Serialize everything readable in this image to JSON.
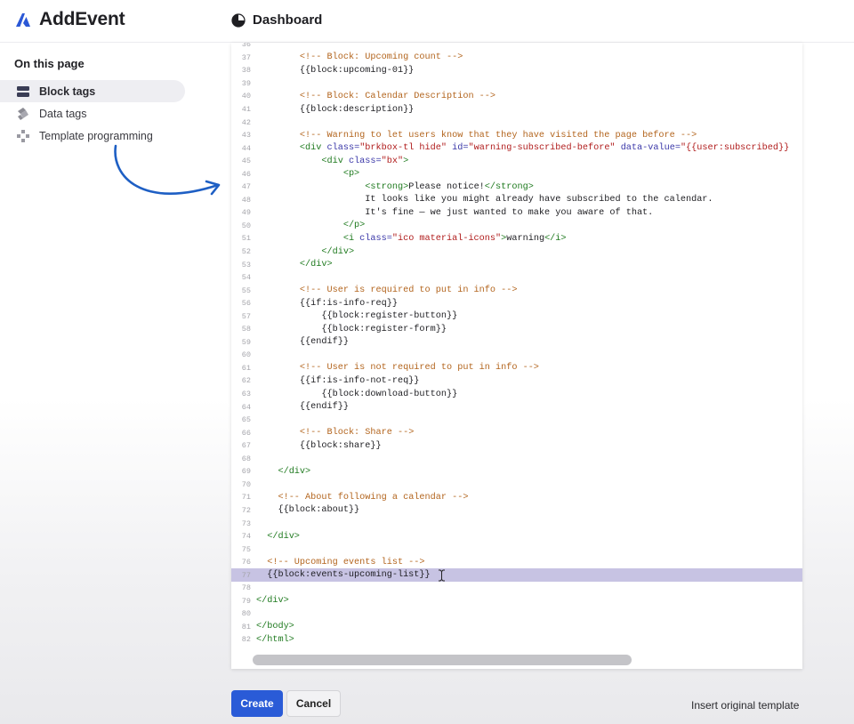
{
  "header": {
    "brand": "AddEvent",
    "nav_item": "Dashboard"
  },
  "sidebar": {
    "title": "On this page",
    "items": [
      {
        "label": "Block tags",
        "icon": "block-tags-icon",
        "active": true
      },
      {
        "label": "Data tags",
        "icon": "data-tags-icon",
        "active": false
      },
      {
        "label": "Template programming",
        "icon": "template-programming-icon",
        "active": false
      }
    ]
  },
  "editor": {
    "highlight_color": "#c7c3e3",
    "lines": [
      {
        "n": "36",
        "segs": [
          [
            "tx",
            ""
          ]
        ]
      },
      {
        "n": "37",
        "segs": [
          [
            "tx",
            "        "
          ],
          [
            "c-com",
            "<!-- Block: Upcoming count -->"
          ]
        ]
      },
      {
        "n": "38",
        "segs": [
          [
            "tx",
            "        {{block:upcoming-01}}"
          ]
        ]
      },
      {
        "n": "39",
        "segs": [
          [
            "tx",
            ""
          ]
        ]
      },
      {
        "n": "40",
        "segs": [
          [
            "tx",
            "        "
          ],
          [
            "c-com",
            "<!-- Block: Calendar Description -->"
          ]
        ]
      },
      {
        "n": "41",
        "segs": [
          [
            "tx",
            "        {{block:description}}"
          ]
        ]
      },
      {
        "n": "42",
        "segs": [
          [
            "tx",
            ""
          ]
        ]
      },
      {
        "n": "43",
        "segs": [
          [
            "tx",
            "        "
          ],
          [
            "c-com",
            "<!-- Warning to let users know that they have visited the page before -->"
          ]
        ]
      },
      {
        "n": "44",
        "segs": [
          [
            "tx",
            "        "
          ],
          [
            "c-tag",
            "<div "
          ],
          [
            "c-attr",
            "class="
          ],
          [
            "c-str",
            "\"brkbox-tl hide\""
          ],
          [
            "tx",
            " "
          ],
          [
            "c-attr",
            "id="
          ],
          [
            "c-str",
            "\"warning-subscribed-before\""
          ],
          [
            "tx",
            " "
          ],
          [
            "c-attr",
            "data-value="
          ],
          [
            "c-str",
            "\"{{user:subscribed}}"
          ]
        ]
      },
      {
        "n": "45",
        "segs": [
          [
            "tx",
            "            "
          ],
          [
            "c-tag",
            "<div "
          ],
          [
            "c-attr",
            "class="
          ],
          [
            "c-str",
            "\"bx\""
          ],
          [
            "c-tag",
            ">"
          ]
        ]
      },
      {
        "n": "46",
        "segs": [
          [
            "tx",
            "                "
          ],
          [
            "c-tag",
            "<p>"
          ]
        ]
      },
      {
        "n": "47",
        "segs": [
          [
            "tx",
            "                    "
          ],
          [
            "c-tag",
            "<strong>"
          ],
          [
            "tx",
            "Please notice!"
          ],
          [
            "c-tag",
            "</strong>"
          ]
        ]
      },
      {
        "n": "48",
        "segs": [
          [
            "tx",
            "                    It looks like you might already have subscribed to the calendar."
          ]
        ]
      },
      {
        "n": "49",
        "segs": [
          [
            "tx",
            "                    It's fine — we just wanted to make you aware of that."
          ]
        ]
      },
      {
        "n": "50",
        "segs": [
          [
            "tx",
            "                "
          ],
          [
            "c-tag",
            "</p>"
          ]
        ]
      },
      {
        "n": "51",
        "segs": [
          [
            "tx",
            "                "
          ],
          [
            "c-tag",
            "<i "
          ],
          [
            "c-attr",
            "class="
          ],
          [
            "c-str",
            "\"ico material-icons\""
          ],
          [
            "c-tag",
            ">"
          ],
          [
            "tx",
            "warning"
          ],
          [
            "c-tag",
            "</i>"
          ]
        ]
      },
      {
        "n": "52",
        "segs": [
          [
            "tx",
            "            "
          ],
          [
            "c-tag",
            "</div>"
          ]
        ]
      },
      {
        "n": "53",
        "segs": [
          [
            "tx",
            "        "
          ],
          [
            "c-tag",
            "</div>"
          ]
        ]
      },
      {
        "n": "54",
        "segs": [
          [
            "tx",
            ""
          ]
        ]
      },
      {
        "n": "55",
        "segs": [
          [
            "tx",
            "        "
          ],
          [
            "c-com",
            "<!-- User is required to put in info -->"
          ]
        ]
      },
      {
        "n": "56",
        "segs": [
          [
            "tx",
            "        {{if:is-info-req}}"
          ]
        ]
      },
      {
        "n": "57",
        "segs": [
          [
            "tx",
            "            {{block:register-button}}"
          ]
        ]
      },
      {
        "n": "58",
        "segs": [
          [
            "tx",
            "            {{block:register-form}}"
          ]
        ]
      },
      {
        "n": "59",
        "segs": [
          [
            "tx",
            "        {{endif}}"
          ]
        ]
      },
      {
        "n": "60",
        "segs": [
          [
            "tx",
            ""
          ]
        ]
      },
      {
        "n": "61",
        "segs": [
          [
            "tx",
            "        "
          ],
          [
            "c-com",
            "<!-- User is not required to put in info -->"
          ]
        ]
      },
      {
        "n": "62",
        "segs": [
          [
            "tx",
            "        {{if:is-info-not-req}}"
          ]
        ]
      },
      {
        "n": "63",
        "segs": [
          [
            "tx",
            "            {{block:download-button}}"
          ]
        ]
      },
      {
        "n": "64",
        "segs": [
          [
            "tx",
            "        {{endif}}"
          ]
        ]
      },
      {
        "n": "65",
        "segs": [
          [
            "tx",
            ""
          ]
        ]
      },
      {
        "n": "66",
        "segs": [
          [
            "tx",
            "        "
          ],
          [
            "c-com",
            "<!-- Block: Share -->"
          ]
        ]
      },
      {
        "n": "67",
        "segs": [
          [
            "tx",
            "        {{block:share}}"
          ]
        ]
      },
      {
        "n": "68",
        "segs": [
          [
            "tx",
            ""
          ]
        ]
      },
      {
        "n": "69",
        "segs": [
          [
            "tx",
            "    "
          ],
          [
            "c-tag",
            "</div>"
          ]
        ]
      },
      {
        "n": "70",
        "segs": [
          [
            "tx",
            ""
          ]
        ]
      },
      {
        "n": "71",
        "segs": [
          [
            "tx",
            "    "
          ],
          [
            "c-com",
            "<!-- About following a calendar -->"
          ]
        ]
      },
      {
        "n": "72",
        "segs": [
          [
            "tx",
            "    {{block:about}}"
          ]
        ]
      },
      {
        "n": "73",
        "segs": [
          [
            "tx",
            ""
          ]
        ]
      },
      {
        "n": "74",
        "segs": [
          [
            "tx",
            "  "
          ],
          [
            "c-tag",
            "</div>"
          ]
        ]
      },
      {
        "n": "75",
        "segs": [
          [
            "tx",
            ""
          ]
        ]
      },
      {
        "n": "76",
        "segs": [
          [
            "tx",
            "  "
          ],
          [
            "c-com",
            "<!-- Upcoming events list -->"
          ]
        ]
      },
      {
        "n": "77",
        "segs": [
          [
            "tx",
            "  {{block:events-upcoming-list}}"
          ]
        ],
        "highlight": true
      },
      {
        "n": "78",
        "segs": [
          [
            "tx",
            ""
          ]
        ]
      },
      {
        "n": "79",
        "segs": [
          [
            "c-tag",
            "</div>"
          ]
        ]
      },
      {
        "n": "80",
        "segs": [
          [
            "tx",
            ""
          ]
        ]
      },
      {
        "n": "81",
        "segs": [
          [
            "c-tag",
            "</body>"
          ]
        ]
      },
      {
        "n": "82",
        "segs": [
          [
            "c-tag",
            "</html>"
          ]
        ]
      }
    ]
  },
  "footer": {
    "create_label": "Create",
    "cancel_label": "Cancel",
    "insert_label": "Insert original template"
  }
}
